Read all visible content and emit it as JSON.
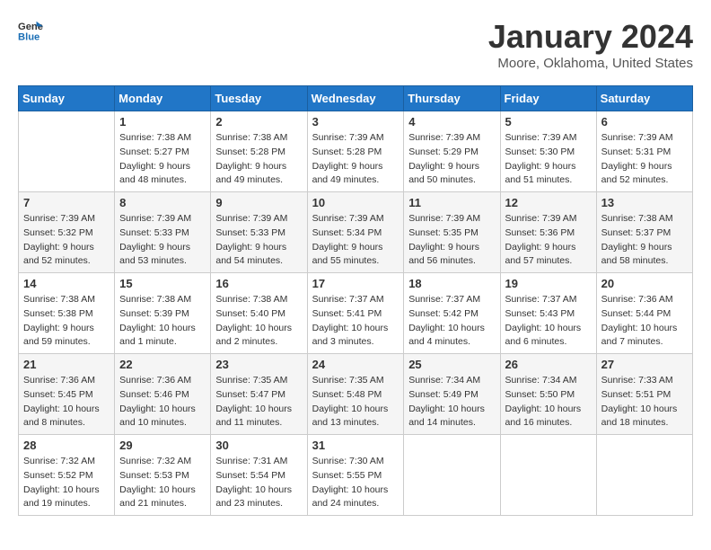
{
  "logo": {
    "general": "General",
    "blue": "Blue"
  },
  "title": "January 2024",
  "subtitle": "Moore, Oklahoma, United States",
  "days_of_week": [
    "Sunday",
    "Monday",
    "Tuesday",
    "Wednesday",
    "Thursday",
    "Friday",
    "Saturday"
  ],
  "weeks": [
    [
      {
        "day": "",
        "sunrise": "",
        "sunset": "",
        "daylight": ""
      },
      {
        "day": "1",
        "sunrise": "Sunrise: 7:38 AM",
        "sunset": "Sunset: 5:27 PM",
        "daylight": "Daylight: 9 hours and 48 minutes."
      },
      {
        "day": "2",
        "sunrise": "Sunrise: 7:38 AM",
        "sunset": "Sunset: 5:28 PM",
        "daylight": "Daylight: 9 hours and 49 minutes."
      },
      {
        "day": "3",
        "sunrise": "Sunrise: 7:39 AM",
        "sunset": "Sunset: 5:28 PM",
        "daylight": "Daylight: 9 hours and 49 minutes."
      },
      {
        "day": "4",
        "sunrise": "Sunrise: 7:39 AM",
        "sunset": "Sunset: 5:29 PM",
        "daylight": "Daylight: 9 hours and 50 minutes."
      },
      {
        "day": "5",
        "sunrise": "Sunrise: 7:39 AM",
        "sunset": "Sunset: 5:30 PM",
        "daylight": "Daylight: 9 hours and 51 minutes."
      },
      {
        "day": "6",
        "sunrise": "Sunrise: 7:39 AM",
        "sunset": "Sunset: 5:31 PM",
        "daylight": "Daylight: 9 hours and 52 minutes."
      }
    ],
    [
      {
        "day": "7",
        "sunrise": "Sunrise: 7:39 AM",
        "sunset": "Sunset: 5:32 PM",
        "daylight": "Daylight: 9 hours and 52 minutes."
      },
      {
        "day": "8",
        "sunrise": "Sunrise: 7:39 AM",
        "sunset": "Sunset: 5:33 PM",
        "daylight": "Daylight: 9 hours and 53 minutes."
      },
      {
        "day": "9",
        "sunrise": "Sunrise: 7:39 AM",
        "sunset": "Sunset: 5:33 PM",
        "daylight": "Daylight: 9 hours and 54 minutes."
      },
      {
        "day": "10",
        "sunrise": "Sunrise: 7:39 AM",
        "sunset": "Sunset: 5:34 PM",
        "daylight": "Daylight: 9 hours and 55 minutes."
      },
      {
        "day": "11",
        "sunrise": "Sunrise: 7:39 AM",
        "sunset": "Sunset: 5:35 PM",
        "daylight": "Daylight: 9 hours and 56 minutes."
      },
      {
        "day": "12",
        "sunrise": "Sunrise: 7:39 AM",
        "sunset": "Sunset: 5:36 PM",
        "daylight": "Daylight: 9 hours and 57 minutes."
      },
      {
        "day": "13",
        "sunrise": "Sunrise: 7:38 AM",
        "sunset": "Sunset: 5:37 PM",
        "daylight": "Daylight: 9 hours and 58 minutes."
      }
    ],
    [
      {
        "day": "14",
        "sunrise": "Sunrise: 7:38 AM",
        "sunset": "Sunset: 5:38 PM",
        "daylight": "Daylight: 9 hours and 59 minutes."
      },
      {
        "day": "15",
        "sunrise": "Sunrise: 7:38 AM",
        "sunset": "Sunset: 5:39 PM",
        "daylight": "Daylight: 10 hours and 1 minute."
      },
      {
        "day": "16",
        "sunrise": "Sunrise: 7:38 AM",
        "sunset": "Sunset: 5:40 PM",
        "daylight": "Daylight: 10 hours and 2 minutes."
      },
      {
        "day": "17",
        "sunrise": "Sunrise: 7:37 AM",
        "sunset": "Sunset: 5:41 PM",
        "daylight": "Daylight: 10 hours and 3 minutes."
      },
      {
        "day": "18",
        "sunrise": "Sunrise: 7:37 AM",
        "sunset": "Sunset: 5:42 PM",
        "daylight": "Daylight: 10 hours and 4 minutes."
      },
      {
        "day": "19",
        "sunrise": "Sunrise: 7:37 AM",
        "sunset": "Sunset: 5:43 PM",
        "daylight": "Daylight: 10 hours and 6 minutes."
      },
      {
        "day": "20",
        "sunrise": "Sunrise: 7:36 AM",
        "sunset": "Sunset: 5:44 PM",
        "daylight": "Daylight: 10 hours and 7 minutes."
      }
    ],
    [
      {
        "day": "21",
        "sunrise": "Sunrise: 7:36 AM",
        "sunset": "Sunset: 5:45 PM",
        "daylight": "Daylight: 10 hours and 8 minutes."
      },
      {
        "day": "22",
        "sunrise": "Sunrise: 7:36 AM",
        "sunset": "Sunset: 5:46 PM",
        "daylight": "Daylight: 10 hours and 10 minutes."
      },
      {
        "day": "23",
        "sunrise": "Sunrise: 7:35 AM",
        "sunset": "Sunset: 5:47 PM",
        "daylight": "Daylight: 10 hours and 11 minutes."
      },
      {
        "day": "24",
        "sunrise": "Sunrise: 7:35 AM",
        "sunset": "Sunset: 5:48 PM",
        "daylight": "Daylight: 10 hours and 13 minutes."
      },
      {
        "day": "25",
        "sunrise": "Sunrise: 7:34 AM",
        "sunset": "Sunset: 5:49 PM",
        "daylight": "Daylight: 10 hours and 14 minutes."
      },
      {
        "day": "26",
        "sunrise": "Sunrise: 7:34 AM",
        "sunset": "Sunset: 5:50 PM",
        "daylight": "Daylight: 10 hours and 16 minutes."
      },
      {
        "day": "27",
        "sunrise": "Sunrise: 7:33 AM",
        "sunset": "Sunset: 5:51 PM",
        "daylight": "Daylight: 10 hours and 18 minutes."
      }
    ],
    [
      {
        "day": "28",
        "sunrise": "Sunrise: 7:32 AM",
        "sunset": "Sunset: 5:52 PM",
        "daylight": "Daylight: 10 hours and 19 minutes."
      },
      {
        "day": "29",
        "sunrise": "Sunrise: 7:32 AM",
        "sunset": "Sunset: 5:53 PM",
        "daylight": "Daylight: 10 hours and 21 minutes."
      },
      {
        "day": "30",
        "sunrise": "Sunrise: 7:31 AM",
        "sunset": "Sunset: 5:54 PM",
        "daylight": "Daylight: 10 hours and 23 minutes."
      },
      {
        "day": "31",
        "sunrise": "Sunrise: 7:30 AM",
        "sunset": "Sunset: 5:55 PM",
        "daylight": "Daylight: 10 hours and 24 minutes."
      },
      {
        "day": "",
        "sunrise": "",
        "sunset": "",
        "daylight": ""
      },
      {
        "day": "",
        "sunrise": "",
        "sunset": "",
        "daylight": ""
      },
      {
        "day": "",
        "sunrise": "",
        "sunset": "",
        "daylight": ""
      }
    ]
  ]
}
